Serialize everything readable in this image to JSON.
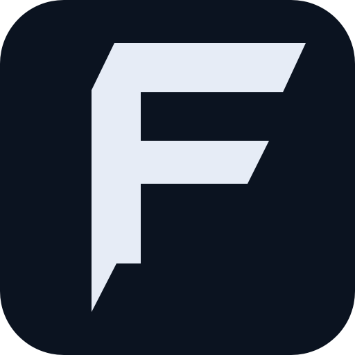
{
  "icon": {
    "name": "app-logo-f",
    "letter": "F",
    "colors": {
      "background": "#0B1320",
      "glyph": "#E6ECF6"
    }
  }
}
